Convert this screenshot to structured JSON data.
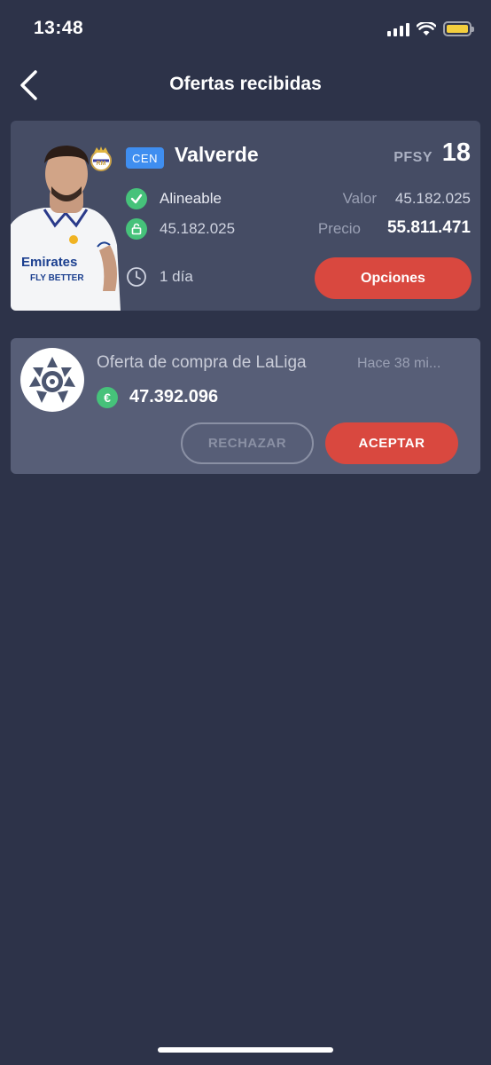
{
  "status_bar": {
    "time": "13:48",
    "battery_color": "#f4cf3e"
  },
  "header": {
    "title": "Ofertas recibidas",
    "back_icon": "chevron-left-icon"
  },
  "player": {
    "position": "CEN",
    "name": "Valverde",
    "pfsy_label": "PFSY",
    "pfsy_points": "18",
    "status": "Alineable",
    "clause_value": "45.182.025",
    "value_label": "Valor",
    "value": "45.182.025",
    "price_label": "Precio",
    "price": "55.811.471",
    "time_left": "1 día",
    "options_label": "Opciones",
    "position_color": "#3f8ef0"
  },
  "offer": {
    "title": "Oferta de compra de LaLiga",
    "time_ago": "Hace 38 mi...",
    "amount": "47.392.096",
    "currency_symbol": "€",
    "reject_label": "RECHAZAR",
    "accept_label": "ACEPTAR",
    "accept_color": "#d9483f"
  },
  "colors": {
    "background": "#2d3349",
    "card": "#454c64",
    "offer_card": "#575e77",
    "accent_red": "#d9483f",
    "accent_green": "#46c27a"
  }
}
